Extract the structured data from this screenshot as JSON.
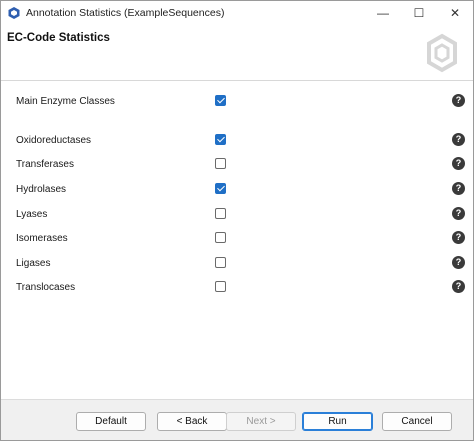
{
  "window": {
    "title": "Annotation Statistics (ExampleSequences)",
    "controls": {
      "minimize": "—",
      "maximize": "☐",
      "close": "✕"
    }
  },
  "header": {
    "title": "EC-Code Statistics"
  },
  "options": [
    {
      "label": "Main Enzyme Classes",
      "checked": true
    },
    {
      "label": "Oxidoreductases",
      "checked": true
    },
    {
      "label": "Transferases",
      "checked": false
    },
    {
      "label": "Hydrolases",
      "checked": true
    },
    {
      "label": "Lyases",
      "checked": false
    },
    {
      "label": "Isomerases",
      "checked": false
    },
    {
      "label": "Ligases",
      "checked": false
    },
    {
      "label": "Translocases",
      "checked": false
    }
  ],
  "help_glyph": "?",
  "buttons": {
    "default": "Default",
    "back": "< Back",
    "next": "Next >",
    "run": "Run",
    "cancel": "Cancel"
  },
  "colors": {
    "accent": "#1f6fc6",
    "help_icon": "#3a3a3a"
  }
}
